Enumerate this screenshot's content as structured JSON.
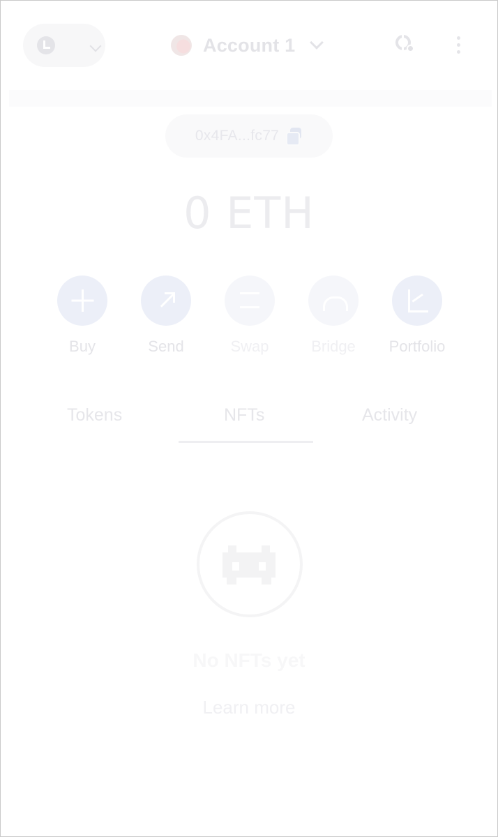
{
  "header": {
    "network_icon": "network-logo-icon",
    "account_name": "Account 1",
    "global_menu_icon": "kebab-menu-icon",
    "connected_sites_icon": "globe-icon"
  },
  "address": {
    "short": "0x4FA...fc77",
    "copy_icon": "copy-icon"
  },
  "balance": {
    "text": "0 ETH"
  },
  "actions": [
    {
      "label": "Buy",
      "icon": "plus-icon"
    },
    {
      "label": "Send",
      "icon": "arrow-up-right-icon"
    },
    {
      "label": "Swap",
      "icon": "swap-arrows-icon"
    },
    {
      "label": "Bridge",
      "icon": "bridge-icon"
    },
    {
      "label": "Portfolio",
      "icon": "chart-icon"
    }
  ],
  "tabs": [
    {
      "label": "Tokens",
      "active": false
    },
    {
      "label": "NFTs",
      "active": true
    },
    {
      "label": "Activity",
      "active": false
    }
  ],
  "empty_state": {
    "icon": "space-invader-icon",
    "title": "No NFTs yet",
    "link": "Learn more"
  },
  "colors": {
    "action_circle": "#eceff8",
    "text_faded": "#e4e4e8"
  }
}
